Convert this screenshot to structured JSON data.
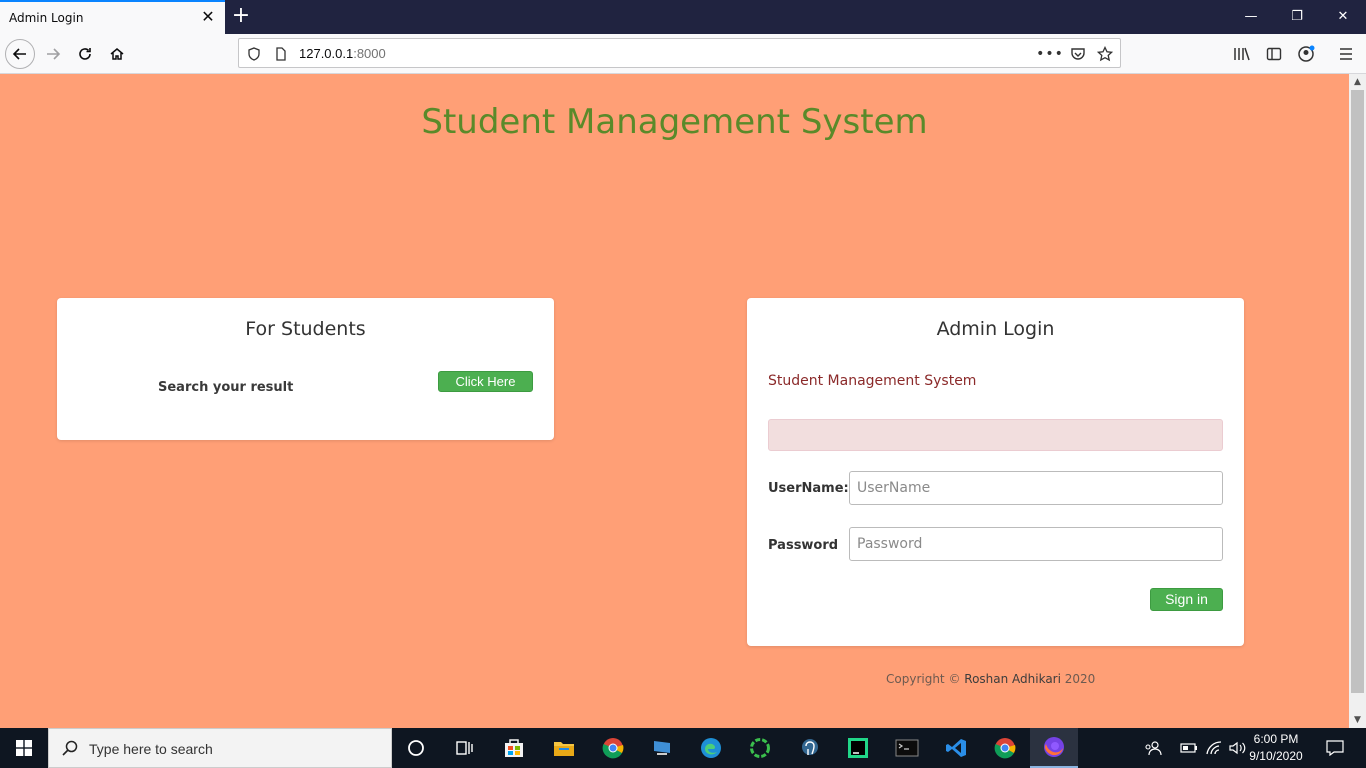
{
  "browser": {
    "tab_title": "Admin Login",
    "tab_close_glyph": "✕",
    "new_tab_glyph": "+",
    "url_host": "127.0.0.1",
    "url_port": ":8000",
    "window_minimize": "—",
    "window_restore": "❐",
    "window_close": "✕"
  },
  "page": {
    "title": "Student Management System",
    "background_color": "#ff9f76",
    "title_color": "#5a8a2a",
    "students": {
      "heading": "For Students",
      "search_text": "Search your result",
      "button_label": "Click Here"
    },
    "admin": {
      "heading": "Admin Login",
      "subtitle": "Student Management System",
      "username_label": "UserName:",
      "username_placeholder": "UserName",
      "username_value": "",
      "password_label": "Password",
      "password_placeholder": "Password",
      "password_value": "",
      "signin_label": "Sign in"
    },
    "footer": {
      "prefix": "Copyright © ",
      "name": "Roshan Adhikari",
      "year": " 2020"
    }
  },
  "taskbar": {
    "search_placeholder": "Type here to search",
    "time": "6:00 PM",
    "date": "9/10/2020",
    "accent_color": "#8bb4e0"
  }
}
